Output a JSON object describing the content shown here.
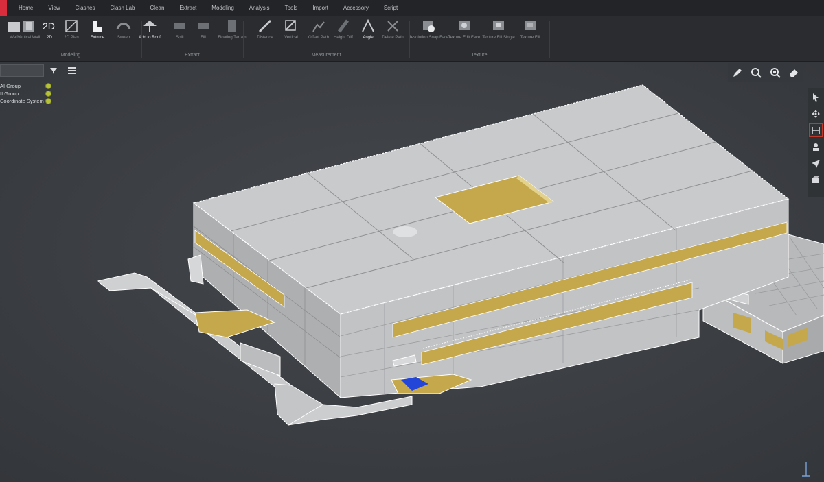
{
  "menu": {
    "items": [
      "Home",
      "View",
      "Clashes",
      "Clash Lab",
      "Clean",
      "Extract",
      "Modeling",
      "Analysis",
      "Tools",
      "Import",
      "Accessory",
      "Script"
    ]
  },
  "ribbon": {
    "groups": [
      {
        "label": "Modeling"
      },
      {
        "label": "Extract"
      },
      {
        "label": "Measurement"
      },
      {
        "label": "Texture"
      }
    ],
    "buttons": [
      {
        "label": "Wall",
        "icon": "wall-icon"
      },
      {
        "label": "Vertical Wall",
        "icon": "vertical-wall-icon"
      },
      {
        "label": "2D",
        "icon": "2d-icon"
      },
      {
        "label": "2D Plan",
        "icon": "2d-plan-icon"
      },
      {
        "label": "Extrude",
        "icon": "extrude-icon"
      },
      {
        "label": "Sweep",
        "icon": "sweep-icon"
      },
      {
        "label": "Add to Roof",
        "icon": "roof-icon"
      },
      {
        "label": "Split",
        "icon": "split-icon"
      },
      {
        "label": "Fill",
        "icon": "fill-icon"
      },
      {
        "label": "Floating Terrain",
        "icon": "terrain-icon"
      },
      {
        "label": "Distance",
        "icon": "distance-icon"
      },
      {
        "label": "Vertical",
        "icon": "vertical-measure-icon"
      },
      {
        "label": "Offset Path",
        "icon": "offset-icon"
      },
      {
        "label": "Height Diff",
        "icon": "height-diff-icon"
      },
      {
        "label": "Angle",
        "icon": "angle-icon"
      },
      {
        "label": "Delete Path",
        "icon": "delete-path-icon"
      },
      {
        "label": "Resolution Snap Face",
        "icon": "snap-face-icon"
      },
      {
        "label": "Texture Edit Face",
        "icon": "texture-edit-icon"
      },
      {
        "label": "Texture Fill Single",
        "icon": "texture-fill-icon"
      },
      {
        "label": "Texture Fill",
        "icon": "texture-fill-all-icon"
      }
    ]
  },
  "tree": {
    "items": [
      "AI Group",
      "II Group",
      "Coordinate System"
    ]
  }
}
